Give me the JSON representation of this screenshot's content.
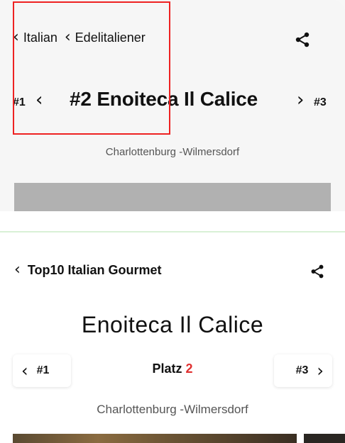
{
  "top": {
    "breadcrumbs": [
      "Italian",
      "Edelitaliener"
    ],
    "prev_rank": "#1",
    "title": "#2 Enoiteca Il Calice",
    "next_rank": "#3",
    "subtitle": "Charlottenburg -Wilmersdorf"
  },
  "bottom": {
    "back_label": "Top10 Italian Gourmet",
    "title": "Enoiteca Il Calice",
    "prev_rank": "#1",
    "platz_label": "Platz",
    "platz_number": "2",
    "next_rank": "#3",
    "subtitle": "Charlottenburg -Wilmersdorf"
  },
  "colors": {
    "accent_red": "#e03030",
    "highlight_box": "#e22222"
  }
}
